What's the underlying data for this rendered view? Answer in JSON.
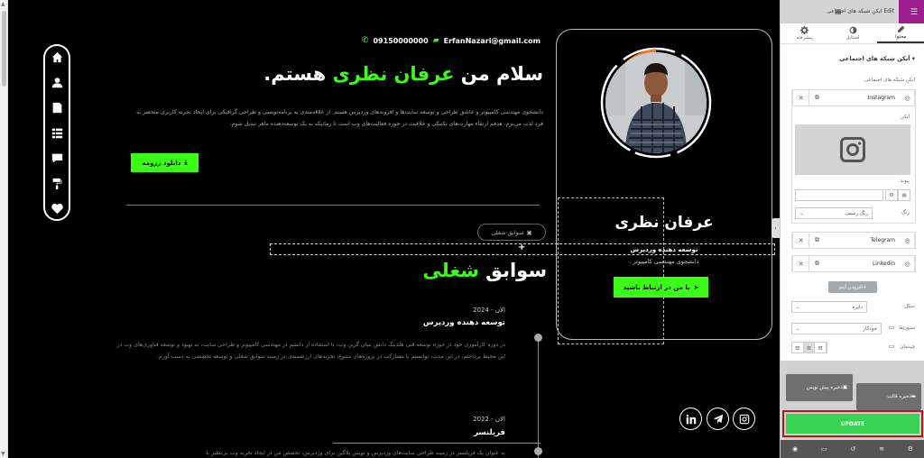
{
  "contact": {
    "email": "ErfanNazari@gmail.com",
    "phone": "09150000000"
  },
  "hero": {
    "title_pre": "سلام من ",
    "title_highlight": "عرفان نظری",
    "title_post": " هستم.",
    "description": "دانشجوی مهندسی کامپیوتر و عاشق طراحی و توسعه سایت‌ها و افزونه‌های وردپرس هستم. از علاقه‌مندی به برنامه‌نویسی و طراحی گرافیکی برای ایجاد تجربه کاربری منحصر به فرد لذت می‌برم. هدفم ارتقاء مهارت‌های تکنیکی و خلاقیت در حوزه فعالیت‌های وب است تا زمانیکه به یک توسعه‌دهنده ماهر تبدیل شوم.",
    "download_label": "دانلود رزومه"
  },
  "section": {
    "pill_label": "سوابق شغلی",
    "title_pre": "سوابق ",
    "title_highlight": "شغلی"
  },
  "jobs": [
    {
      "date": "الان - 2024",
      "title": "توسعه دهنده وردپرس",
      "description": "در دوره کارآموزی خود در حوزه توسعه فنی هلدینگ دانش بنیان گرین وب، با استفاده از دانشم در مهندسی کامپیوتر و طراحی سایت، به بهبود و توسعه فناوری‌های وب در این محیط پرداختم. در این مدت، توانستم با مشارکت در پروژه‌های متنوع، تجربه‌های ارزشمندی در زمینه سوابق شغلی و توسعه تخصصی به دست آورم."
    },
    {
      "date": "الان - 2022",
      "title": "فریلنسر",
      "description": "به عنوان یک فریلنسر در زمینه طراحی سایت‌های وردپرس و نویس پلاگین برای وردپرس، تخصص من در ایجاد تجربه وب بی‌نظیر با"
    }
  ],
  "profile": {
    "name": "عرفان نظری",
    "role": "توسعه دهنده وردپرس",
    "subtitle": "دانشجوی مهندسی کامپیوتر .",
    "contact_label": "با من در ارتباط باشید"
  },
  "panel": {
    "header_title": "ایکن شبکه های اجتماعی",
    "header_edit": "Edit",
    "tabs": [
      {
        "label": "محتوا",
        "icon": "pencil-icon"
      },
      {
        "label": "استایل",
        "icon": "contrast-icon"
      },
      {
        "label": "پیشرفته",
        "icon": "gear-icon"
      }
    ],
    "section_heading": "آیکن شبکه های اجتماعی",
    "repeater_label": "آیکن شبکه های اجتماعی",
    "items": [
      "Instagram",
      "Telegram",
      "Linkedin"
    ],
    "icon_label": "آیکن",
    "link_label": "پیوند",
    "color_label": "رنگ",
    "color_value": "رنگ رسمی",
    "add_item_label": "افزودن آیتم",
    "shape_label": "شکل",
    "shape_value": "دایره",
    "columns_label": "ستون‌ها",
    "columns_value": "خودکار",
    "align_label": "چیدمان",
    "save_template_label": "ذخیره قالب",
    "save_draft_label": "ذخیره پیش نویس",
    "update_label": "UPDATE"
  },
  "colors": {
    "accent": "#39ff14",
    "panel_accent": "#9b1e8c",
    "update": "#39d353"
  }
}
